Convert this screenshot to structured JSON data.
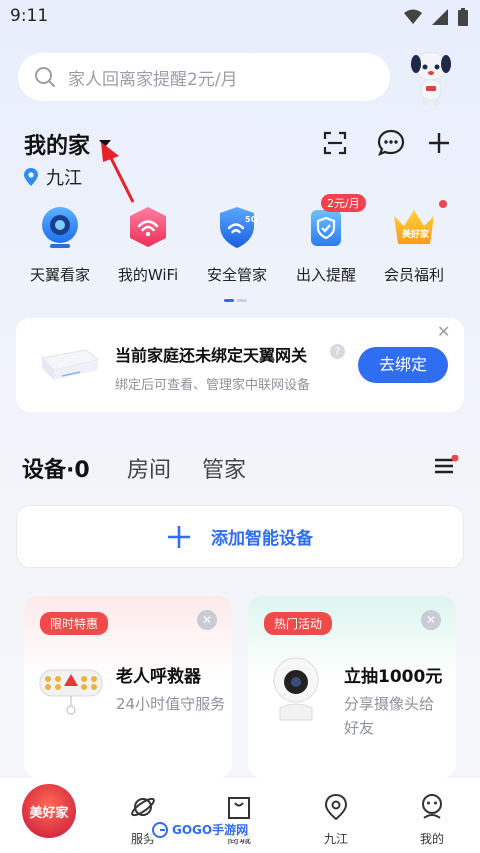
{
  "status_bar": {
    "time": "9:11"
  },
  "search": {
    "placeholder": "家人回离家提醒2元/月"
  },
  "home": {
    "title": "我的家",
    "location": "九江"
  },
  "quick_entries": [
    {
      "label": "天翼看家",
      "icon": "camera-icon"
    },
    {
      "label": "我的WiFi",
      "icon": "wifi-icon"
    },
    {
      "label": "安全管家",
      "icon": "shield-5g-icon",
      "badge_text": "5G"
    },
    {
      "label": "出入提醒",
      "icon": "door-shield-icon",
      "badge": "2元/月"
    },
    {
      "label": "会员福利",
      "icon": "crown-icon",
      "badge_text": "美好家"
    }
  ],
  "gateway_card": {
    "title": "当前家庭还未绑定天翼网关",
    "subtitle": "绑定后可查看、管理家中联网设备",
    "button": "去绑定",
    "help": "?"
  },
  "tabs": [
    {
      "label": "设备·0",
      "active": true
    },
    {
      "label": "房间",
      "active": false
    },
    {
      "label": "管家",
      "active": false
    }
  ],
  "add_device": {
    "label": "添加智能设备"
  },
  "promos": [
    {
      "tag": "限时特惠",
      "title": "老人呼救器",
      "subtitle": "24小时值守服务",
      "tag_color": "#f04a4a"
    },
    {
      "tag": "热门活动",
      "title": "立抽1000元",
      "subtitle": "分享摄像头给好友",
      "tag_color": "#f04a4a"
    }
  ],
  "bottom_nav": {
    "logo_text": "美好家",
    "items": [
      {
        "label": "服务",
        "icon": "planet-icon"
      },
      {
        "label": "商城",
        "icon": "bag-icon"
      },
      {
        "label": "九江",
        "icon": "location-icon"
      },
      {
        "label": "我的",
        "icon": "user-icon"
      }
    ]
  },
  "watermark": {
    "text": "GOGO手游网"
  },
  "colors": {
    "accent": "#2f6df2",
    "badge_red": "#f4414e"
  }
}
